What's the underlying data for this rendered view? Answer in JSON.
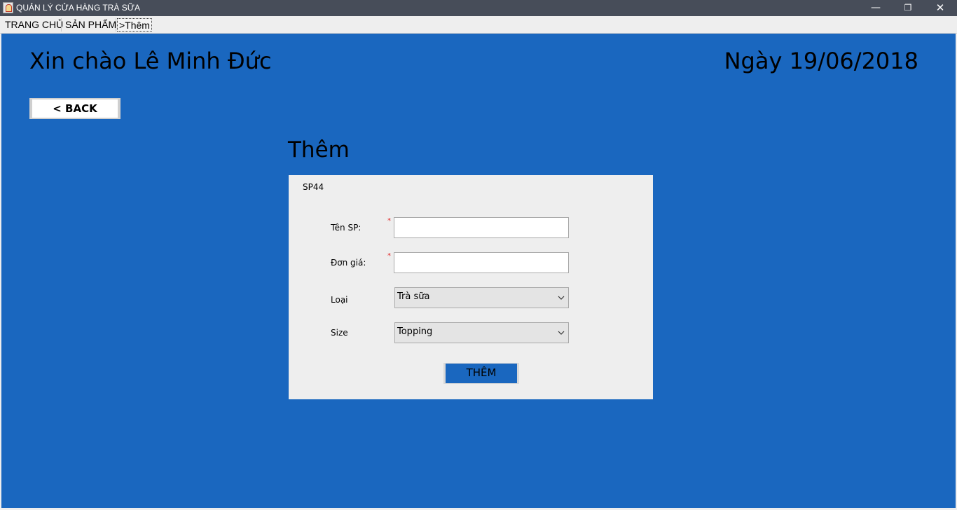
{
  "window": {
    "title": "QUẢN LÝ CỬA HÀNG TRÀ SỮA",
    "minimize_glyph": "—",
    "maximize_glyph": "❐",
    "close_glyph": "✕"
  },
  "menu": {
    "items": [
      {
        "label": "TRANG CHỦ"
      },
      {
        "label": "SẢN PHẨM"
      },
      {
        "label": ">Thêm"
      }
    ]
  },
  "header": {
    "greeting": "Xin chào Lê Minh Đức",
    "date": "Ngày 19/06/2018"
  },
  "back_button": {
    "label": "< BACK"
  },
  "page": {
    "heading": "Thêm"
  },
  "form": {
    "product_code": "SP44",
    "fields": {
      "name": {
        "label": "Tên SP:",
        "value": "",
        "required_mark": "*"
      },
      "price": {
        "label": "Đơn giá:",
        "value": "",
        "required_mark": "*"
      },
      "type": {
        "label": "Loại",
        "selected": "Trà sữa"
      },
      "size": {
        "label": "Size",
        "selected": "Topping"
      }
    },
    "submit_label": "THÊM"
  },
  "colors": {
    "background": "#1a67bf",
    "titlebar": "#474d59",
    "panel": "#eeeeee",
    "required": "#e02020"
  }
}
